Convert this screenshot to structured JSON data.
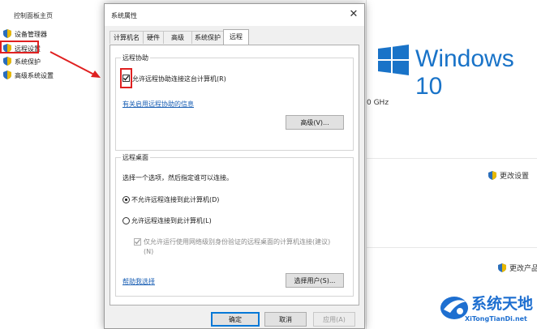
{
  "control_panel": {
    "home": "控制面板主页",
    "links": [
      {
        "label": "设备管理器"
      },
      {
        "label": "远程设置"
      },
      {
        "label": "系统保护"
      },
      {
        "label": "高级系统设置"
      }
    ]
  },
  "background": {
    "windows_text": "Windows 10",
    "cpu_fragment": "0 GHz",
    "change_settings": "更改设置",
    "change_product_key": "更改产品密"
  },
  "dialog": {
    "title": "系统属性",
    "tabs": [
      {
        "label": "计算机名",
        "active": false
      },
      {
        "label": "硬件",
        "active": false
      },
      {
        "label": "高级",
        "active": false
      },
      {
        "label": "系统保护",
        "active": false
      },
      {
        "label": "远程",
        "active": true
      }
    ],
    "remote_assistance": {
      "group_title": "远程协助",
      "allow_label": "允许远程协助连接这台计算机(R)",
      "allow_checked": true,
      "info_link": "有关启用远程协助的信息",
      "advanced_button": "高级(V)..."
    },
    "remote_desktop": {
      "group_title": "远程桌面",
      "instruction": "选择一个选项，然后指定谁可以连接。",
      "option_deny": "不允许远程连接到此计算机(D)",
      "option_allow": "允许远程连接到此计算机(L)",
      "selected": "deny",
      "nla_label_line1": "仅允许运行使用网络级别身份验证的远程桌面的计算机连接(建议)",
      "nla_label_line2": "(N)",
      "nla_checked": true,
      "help_link": "帮助我选择",
      "select_users_button": "选择用户(S)..."
    },
    "buttons": {
      "ok": "确定",
      "cancel": "取消",
      "apply": "应用(A)"
    }
  },
  "watermark": {
    "title": "系统天地",
    "url": "XiTongTianDi.net"
  },
  "colors": {
    "highlight_red": "#e02020",
    "link_blue": "#1a5fb4",
    "windows_blue": "#1973c8"
  }
}
